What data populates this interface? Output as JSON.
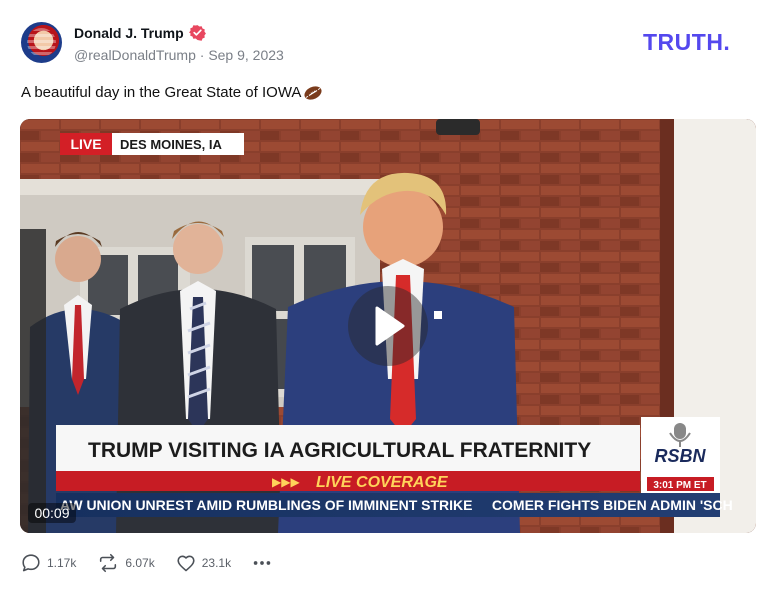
{
  "author": {
    "name": "Donald J. Trump",
    "handle": "@realDonaldTrump",
    "separator": "·",
    "date": "Sep 9, 2023"
  },
  "brand": {
    "text": "TRUTH.",
    "color": "#5448ee"
  },
  "post": {
    "text": "A beautiful day in the Great State of IOWA",
    "emoji_icon": "american-football-icon"
  },
  "video": {
    "live_badge": "LIVE",
    "location": "DES MOINES, IA",
    "headline": "TRUMP VISITING IA AGRICULTURAL FRATERNITY",
    "live_coverage": "LIVE COVERAGE",
    "network": "RSBN",
    "time": "3:01 PM ET",
    "ticker": "AW UNION UNREST AMID RUMBLINGS OF IMMINENT STRIKE     COMER FIGHTS BIDEN ADMIN 'SCH",
    "elapsed": "00:09",
    "play_icon": "play-icon"
  },
  "actions": {
    "replies": "1.17k",
    "retruths": "6.07k",
    "likes": "23.1k"
  },
  "colors": {
    "text": "#0f1419",
    "muted": "#7a7f87",
    "live_red": "#d31f26",
    "navy": "#1a2a5c",
    "verified": "#e8475f"
  }
}
